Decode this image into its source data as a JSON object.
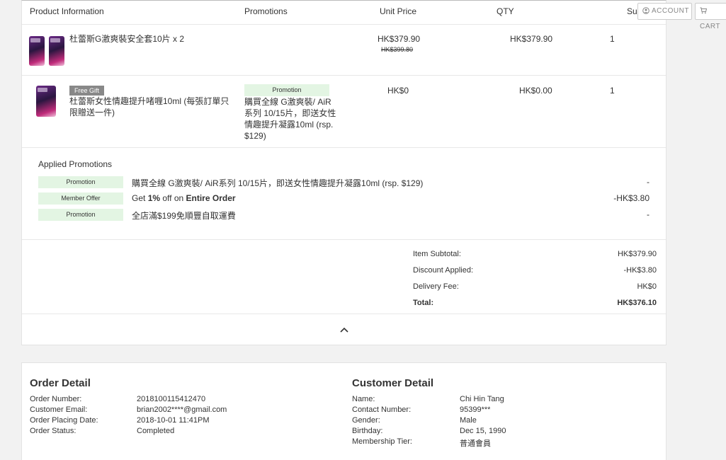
{
  "header": {
    "columns": [
      "Product Information",
      "Promotions",
      "Unit Price",
      "QTY",
      "Subtotal"
    ],
    "account_label": "ACCOUNT",
    "cart_label": "CART"
  },
  "items": [
    {
      "name": "杜蕾斯G激爽裝安全套10片 x 2",
      "unit_price": "HK$379.90",
      "original_price": "HK$399.80",
      "qty_column": "HK$379.90",
      "subtotal_column": "1"
    },
    {
      "badge": "Free Gift",
      "name": "杜蕾斯女性情趣提升啫喱10ml (每張訂單只限贈送一件)",
      "promo_tag": "Promotion",
      "promo_text": "購買全線 G激爽裝/ AiR系列 10/15片，即送女性情趣提升凝露10ml (rsp. $129)",
      "unit_price": "HK$0",
      "qty_column": "HK$0.00",
      "subtotal_column": "1"
    }
  ],
  "applied_promotions": {
    "title": "Applied Promotions",
    "rows": [
      {
        "tag": "Promotion",
        "desc": "購買全線 G激爽裝/ AiR系列 10/15片，即送女性情趣提升凝露10ml (rsp. $129)",
        "value": "-"
      },
      {
        "tag": "Member Offer",
        "desc_prefix": "Get ",
        "desc_pct": "1%",
        "desc_mid": " off on ",
        "desc_target": "Entire Order",
        "value": "-HK$3.80"
      },
      {
        "tag": "Promotion",
        "desc": "全店滿$199免順豐自取運費",
        "value": "-"
      }
    ]
  },
  "summary": {
    "item_subtotal_label": "Item Subtotal:",
    "item_subtotal": "HK$379.90",
    "discount_label": "Discount Applied:",
    "discount": "-HK$3.80",
    "delivery_label": "Delivery Fee:",
    "delivery": "HK$0",
    "total_label": "Total:",
    "total": "HK$376.10"
  },
  "order_detail": {
    "title": "Order Detail",
    "number_label": "Order Number:",
    "number": "2018100115412470",
    "email_label": "Customer Email:",
    "email": "brian2002****@gmail.com",
    "date_label": "Order Placing Date:",
    "date": "2018-10-01 11:41PM",
    "status_label": "Order Status:",
    "status": "Completed"
  },
  "customer_detail": {
    "title": "Customer Detail",
    "name_label": "Name:",
    "name": "Chi Hin Tang",
    "contact_label": "Contact Number:",
    "contact": "95399***",
    "gender_label": "Gender:",
    "gender": "Male",
    "birthday_label": "Birthday:",
    "birthday": "Dec 15, 1990",
    "tier_label": "Membership Tier:",
    "tier": "普通會員"
  }
}
